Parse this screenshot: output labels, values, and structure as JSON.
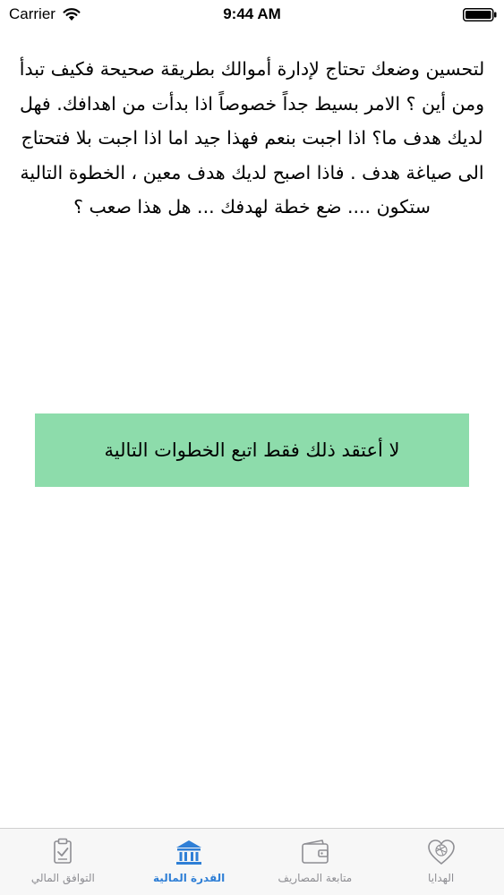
{
  "status_bar": {
    "carrier": "Carrier",
    "time": "9:44 AM"
  },
  "content": {
    "paragraph": "لتحسين وضعك تحتاج لإدارة أموالك بطريقة صحيحة فكيف تبدأ ومن أين ؟ الامر بسيط جداً خصوصاً اذا بدأت من اهدافك. فهل لديك هدف ما؟ اذا اجبت بنعم فهذا جيد اما اذا اجبت بلا فتحتاج الى صياغة هدف . فاذا اصبح لديك هدف معين ، الخطوة التالية ستكون .... ضع خطة لهدفك ... هل هذا صعب ؟",
    "button_label": "لا أعتقد ذلك فقط اتبع الخطوات التالية",
    "button_color": "#8ddcab"
  },
  "tab_bar": {
    "active_color": "#2f7fd6",
    "inactive_color": "#8e8e93",
    "tabs": [
      {
        "label": "التوافق المالي",
        "icon": "clipboard-check-icon"
      },
      {
        "label": "القدرة المالية",
        "icon": "bank-icon",
        "active": true
      },
      {
        "label": "متابعة المصاريف",
        "icon": "wallet-icon"
      },
      {
        "label": "الهدايا",
        "icon": "heart-icon"
      }
    ]
  }
}
